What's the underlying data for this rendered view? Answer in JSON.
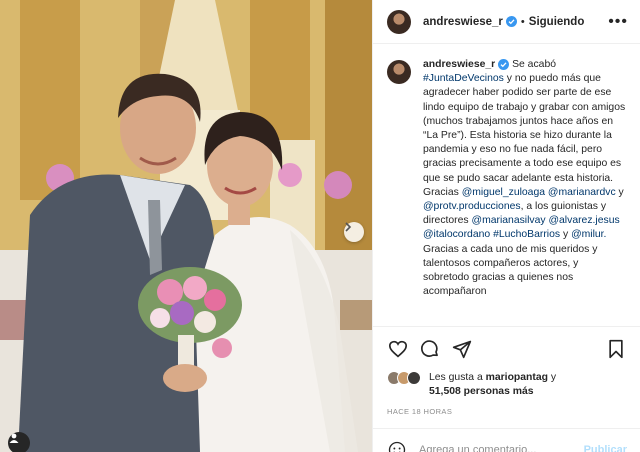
{
  "post": {
    "username": "andreswiese_r",
    "follow_separator": "•",
    "follow_label": "Siguiendo",
    "more_label": "•••"
  },
  "caption": {
    "username": "andreswiese_r",
    "seg1": " Se acabó ",
    "tag1": "#JuntaDeVecinos",
    "seg2": " y no puedo más que agradecer haber podido ser parte de ese lindo equipo de trabajo y grabar con amigos (muchos trabajamos juntos hace años en “La Pre”). Esta historia se hizo durante la pandemia y eso no fue nada fácil, pero gracias precisamente a todo ese equipo es que se pudo sacar adelante esta historia. Gracias ",
    "m1": "@miguel_zuloaga",
    "m2": "@marianardvc",
    "seg3": " y ",
    "m3": "@protv.producciones",
    "seg4": ", a los guionistas y directores ",
    "m4": "@marianasilvay",
    "m5": "@alvarez.jesus",
    "m6": "@italocordano",
    "tag2": "#LuchoBarrios",
    "seg5": " y ",
    "m7": "@milur.",
    "seg6": " Gracias a cada uno de mis queridos y talentosos compañeros actores, y sobretodo gracias a quienes nos acompañaron"
  },
  "likes": {
    "prefix": "Les gusta a ",
    "user": "mariopantag",
    "connector": " y",
    "count": "51,508 personas más"
  },
  "timestamp": "HACE 18 HORAS",
  "comment": {
    "placeholder": "Agrega un comentario...",
    "publish": "Publicar"
  },
  "icons": [
    "heart-icon",
    "comment-icon",
    "share-icon",
    "bookmark-icon",
    "emoji-icon",
    "verified-icon",
    "chevron-right-icon",
    "user-tag-icon"
  ],
  "colors": {
    "link": "#00376b",
    "verified": "#3897f0",
    "muted": "#8e8e8e",
    "publish_disabled": "#b2dffc",
    "border": "#efefef"
  }
}
